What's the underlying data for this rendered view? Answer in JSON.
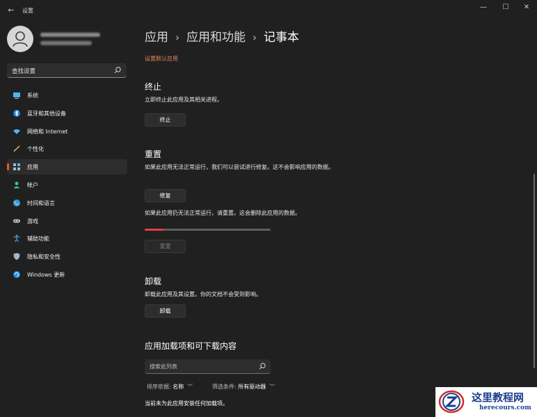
{
  "window": {
    "title": "设置",
    "back_icon": "back-arrow-icon",
    "minimize_glyph": "—",
    "maximize_glyph": "☐",
    "close_glyph": "✕"
  },
  "sidebar": {
    "search": {
      "placeholder": "查找设置"
    },
    "items": [
      {
        "label": "系统",
        "icon": "system-icon",
        "active": false
      },
      {
        "label": "蓝牙和其他设备",
        "icon": "bluetooth-icon",
        "active": false
      },
      {
        "label": "网络和 Internet",
        "icon": "wifi-icon",
        "active": false
      },
      {
        "label": "个性化",
        "icon": "brush-icon",
        "active": false
      },
      {
        "label": "应用",
        "icon": "apps-icon",
        "active": true
      },
      {
        "label": "帐户",
        "icon": "account-icon",
        "active": false
      },
      {
        "label": "时间和语言",
        "icon": "globe-icon",
        "active": false
      },
      {
        "label": "游戏",
        "icon": "gamepad-icon",
        "active": false
      },
      {
        "label": "辅助功能",
        "icon": "accessibility-icon",
        "active": false
      },
      {
        "label": "隐私和安全性",
        "icon": "shield-icon",
        "active": false
      },
      {
        "label": "Windows 更新",
        "icon": "update-icon",
        "active": false
      }
    ]
  },
  "main": {
    "breadcrumb": [
      "应用",
      "应用和功能",
      "记事本"
    ],
    "default_apps_link": "设置默认应用",
    "terminate": {
      "heading": "终止",
      "description": "立即终止此应用及其相关进程。",
      "button": "终止"
    },
    "reset": {
      "heading": "重置",
      "repair_description": "如果此应用无法正常运行，我们可以尝试进行修复。这不会影响应用的数据。",
      "repair_button": "修复",
      "reset_description": "如果此应用仍无法正常运行，请重置。这会删除此应用的数据。",
      "progress_fraction": 0.15,
      "reset_button": "重置"
    },
    "uninstall": {
      "heading": "卸载",
      "description": "卸载此应用及其设置。你的文档不会受到影响。",
      "button": "卸载"
    },
    "addons": {
      "heading": "应用加载项和可下载内容",
      "search_placeholder": "搜索此列表",
      "sort_label": "排序依据:",
      "sort_value": "名称",
      "filter_label": "筛选条件:",
      "filter_value": "所有驱动器",
      "empty_message": "当前未为此应用安装任何加载项。"
    }
  },
  "watermark": {
    "title": "这里教程网",
    "url": "herecours.com"
  },
  "colors": {
    "accent": "#e05a2b",
    "link": "#e2865b",
    "progress": "#e0413a",
    "background": "#202020"
  }
}
